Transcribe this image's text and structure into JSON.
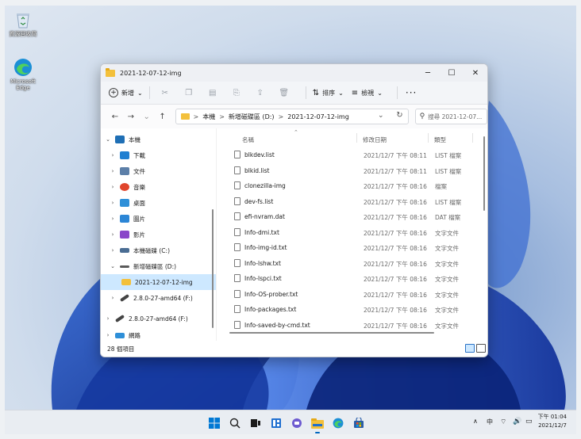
{
  "desktop": {
    "icons": [
      {
        "label": "資源回收筒",
        "icon": "recycle-bin-icon"
      },
      {
        "label": "Microsoft Edge",
        "icon": "edge-icon"
      }
    ]
  },
  "window": {
    "title": "2021-12-07-12-img",
    "controls": {
      "minimize": "─",
      "maximize": "☐",
      "close": "✕"
    },
    "toolbar": {
      "new_label": "新增",
      "sort_label": "排序",
      "view_label": "檢視",
      "more_label": "···"
    },
    "address": {
      "crumbs": [
        "本機",
        "新增磁碟區 (D:)",
        "2021-12-07-12-img"
      ],
      "separator": ">"
    },
    "search": {
      "placeholder": "搜尋 2021-12-07..."
    },
    "nav_items": [
      {
        "label": "本機",
        "icon": "pc-icon",
        "color": "#1f6fb5",
        "expanded": true
      },
      {
        "label": "下載",
        "icon": "download-icon",
        "color": "#1f7fd1"
      },
      {
        "label": "文件",
        "icon": "documents-icon",
        "color": "#5c7fa8"
      },
      {
        "label": "音樂",
        "icon": "music-icon",
        "color": "#e0452c"
      },
      {
        "label": "桌面",
        "icon": "desktop-icon",
        "color": "#2e8fd8"
      },
      {
        "label": "圖片",
        "icon": "pictures-icon",
        "color": "#2c86d6"
      },
      {
        "label": "影片",
        "icon": "videos-icon",
        "color": "#8a46c9"
      },
      {
        "label": "本機磁碟 (C:)",
        "icon": "drive-c-icon",
        "color": "#4a6d93"
      },
      {
        "label": "新增磁碟區 (D:)",
        "icon": "drive-d-icon",
        "color": "#5a5a5a",
        "expanded": true
      },
      {
        "label": "2021-12-07-12-img",
        "icon": "folder-icon",
        "color": "#f3c03b",
        "selected": true
      },
      {
        "label": "2.8.0-27-amd64 (F:)",
        "icon": "usb-drive-icon",
        "color": "#444"
      },
      {
        "label": "2.8.0-27-amd64 (F:)",
        "icon": "usb-drive-icon",
        "color": "#444"
      },
      {
        "label": "網路",
        "icon": "network-icon",
        "color": "#2e8fd8"
      }
    ],
    "columns": {
      "name": "名稱",
      "date": "修改日期",
      "type": "類型"
    },
    "files": [
      {
        "name": "blkdev.list",
        "date": "2021/12/7 下午 08:11",
        "type": "LIST 檔案"
      },
      {
        "name": "blkid.list",
        "date": "2021/12/7 下午 08:11",
        "type": "LIST 檔案"
      },
      {
        "name": "clonezilla-img",
        "date": "2021/12/7 下午 08:16",
        "type": "檔案"
      },
      {
        "name": "dev-fs.list",
        "date": "2021/12/7 下午 08:16",
        "type": "LIST 檔案"
      },
      {
        "name": "efi-nvram.dat",
        "date": "2021/12/7 下午 08:16",
        "type": "DAT 檔案"
      },
      {
        "name": "Info-dmi.txt",
        "date": "2021/12/7 下午 08:16",
        "type": "文字文件"
      },
      {
        "name": "Info-img-id.txt",
        "date": "2021/12/7 下午 08:16",
        "type": "文字文件"
      },
      {
        "name": "Info-lshw.txt",
        "date": "2021/12/7 下午 08:16",
        "type": "文字文件"
      },
      {
        "name": "Info-lspci.txt",
        "date": "2021/12/7 下午 08:16",
        "type": "文字文件"
      },
      {
        "name": "Info-OS-prober.txt",
        "date": "2021/12/7 下午 08:16",
        "type": "文字文件"
      },
      {
        "name": "Info-packages.txt",
        "date": "2021/12/7 下午 08:16",
        "type": "文字文件"
      },
      {
        "name": "Info-saved-by-cmd.txt",
        "date": "2021/12/7 下午 08:16",
        "type": "文字文件"
      }
    ],
    "status": {
      "count": "28 個項目"
    }
  },
  "taskbar": {
    "apps": [
      "windows-start-icon",
      "search-icon",
      "task-view-icon",
      "widgets-icon",
      "chat-icon",
      "file-explorer-icon",
      "edge-icon",
      "store-icon"
    ],
    "tray": {
      "chevron": "∧",
      "ime": "中"
    },
    "clock": {
      "time": "下午 01:04",
      "date": "2021/12/7"
    }
  },
  "colors": {
    "accent": "#0067c0",
    "selection": "#cde8ff",
    "folder": "#f3c03b"
  }
}
